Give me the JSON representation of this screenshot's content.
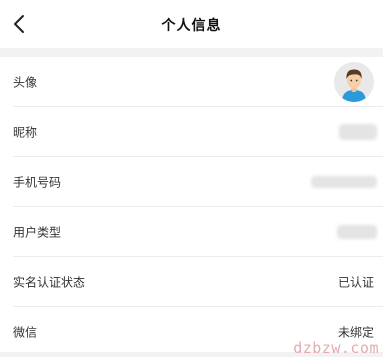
{
  "header": {
    "title": "个人信息",
    "back_icon": "chevron-left-icon"
  },
  "rows": [
    {
      "label": "头像",
      "value_type": "avatar",
      "icon": "avatar-male-icon"
    },
    {
      "label": "昵称",
      "value_type": "blurred"
    },
    {
      "label": "手机号码",
      "value_type": "blurred"
    },
    {
      "label": "用户类型",
      "value_type": "blurred"
    },
    {
      "label": "实名认证状态",
      "value": "已认证"
    },
    {
      "label": "微信",
      "value": "未绑定"
    }
  ],
  "watermark": {
    "text": "dzbzw.com",
    "color": "#e3aab0"
  },
  "colors": {
    "section_gap": "#f2f2f2",
    "divider": "#ececec",
    "avatar_shirt": "#2a9ad8",
    "avatar_hair": "#5a3a22",
    "avatar_skin": "#f6cfa6"
  }
}
